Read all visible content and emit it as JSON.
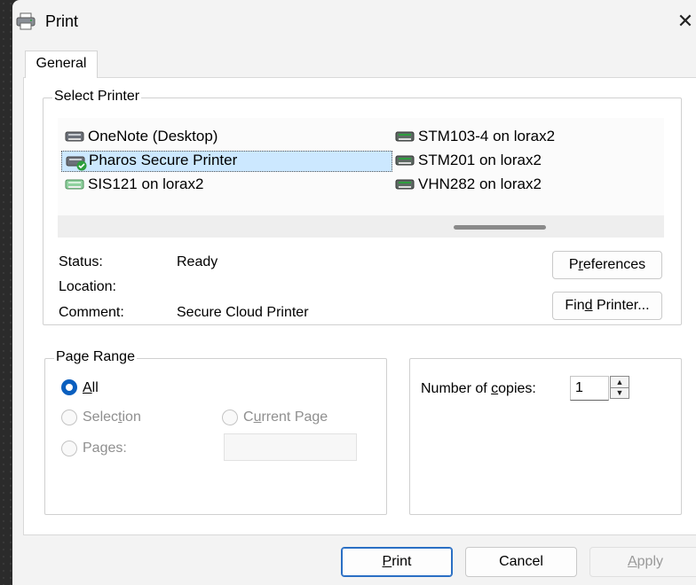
{
  "window": {
    "title": "Print",
    "close_symbol": "✕"
  },
  "tabs": [
    {
      "label": "General"
    }
  ],
  "select_printer": {
    "legend": "Select Printer",
    "printers": [
      {
        "name": "OneNote (Desktop)",
        "selected": false
      },
      {
        "name": "Pharos Secure Printer",
        "selected": true
      },
      {
        "name": "SIS121 on lorax2",
        "selected": false
      },
      {
        "name": "STM103-4 on lorax2",
        "selected": false
      },
      {
        "name": "STM201 on lorax2",
        "selected": false
      },
      {
        "name": "VHN282 on lorax2",
        "selected": false
      }
    ],
    "status_label": "Status:",
    "status_value": "Ready",
    "location_label": "Location:",
    "location_value": "",
    "comment_label": "Comment:",
    "comment_value": "Secure Cloud Printer",
    "preferences_button": {
      "pre": "P",
      "u": "r",
      "post": "eferences"
    },
    "find_printer_button": {
      "pre": "Fin",
      "u": "d",
      "post": " Printer..."
    }
  },
  "page_range": {
    "legend": "Page Range",
    "all": {
      "pre": "",
      "u": "A",
      "post": "ll",
      "checked": true
    },
    "selection": {
      "pre": "Selec",
      "u": "t",
      "post": "ion",
      "checked": false
    },
    "current_page": {
      "pre": "C",
      "u": "u",
      "post": "rrent Page",
      "checked": false
    },
    "pages": {
      "pre": "Pa",
      "u": "g",
      "post": "es:",
      "checked": false
    },
    "pages_input_value": ""
  },
  "copies": {
    "label_pre": "Number of ",
    "label_u": "c",
    "label_post": "opies:",
    "value": "1"
  },
  "footer": {
    "print_button": {
      "pre": "",
      "u": "P",
      "post": "rint"
    },
    "cancel_button": "Cancel",
    "apply_button": {
      "pre": "",
      "u": "A",
      "post": "pply"
    }
  },
  "colors": {
    "accent": "#0a5fbf",
    "selection_bg": "#cce8ff",
    "status_ok_badge": "#2e9e3e"
  },
  "icons": {
    "title": "printer-icon",
    "printer": "printer-icon",
    "default_printer_badge": "checkmark-badge-icon"
  }
}
